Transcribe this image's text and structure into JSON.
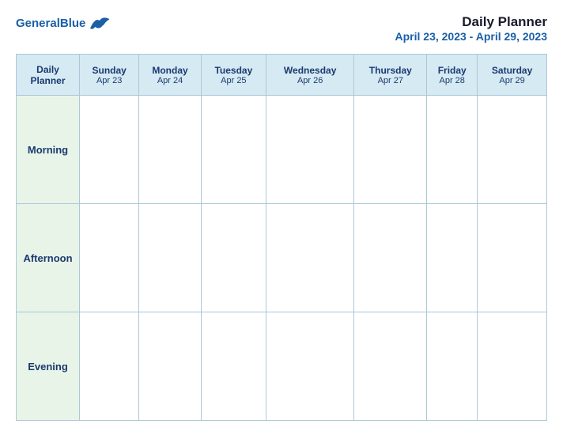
{
  "header": {
    "logo": {
      "text_general": "General",
      "text_blue": "Blue"
    },
    "title": "Daily Planner",
    "date_range": "April 23, 2023 - April 29, 2023"
  },
  "columns": [
    {
      "label": "Daily\nPlanner",
      "date": ""
    },
    {
      "label": "Sunday",
      "date": "Apr 23"
    },
    {
      "label": "Monday",
      "date": "Apr 24"
    },
    {
      "label": "Tuesday",
      "date": "Apr 25"
    },
    {
      "label": "Wednesday",
      "date": "Apr 26"
    },
    {
      "label": "Thursday",
      "date": "Apr 27"
    },
    {
      "label": "Friday",
      "date": "Apr 28"
    },
    {
      "label": "Saturday",
      "date": "Apr 29"
    }
  ],
  "rows": [
    {
      "label": "Morning"
    },
    {
      "label": "Afternoon"
    },
    {
      "label": "Evening"
    }
  ]
}
